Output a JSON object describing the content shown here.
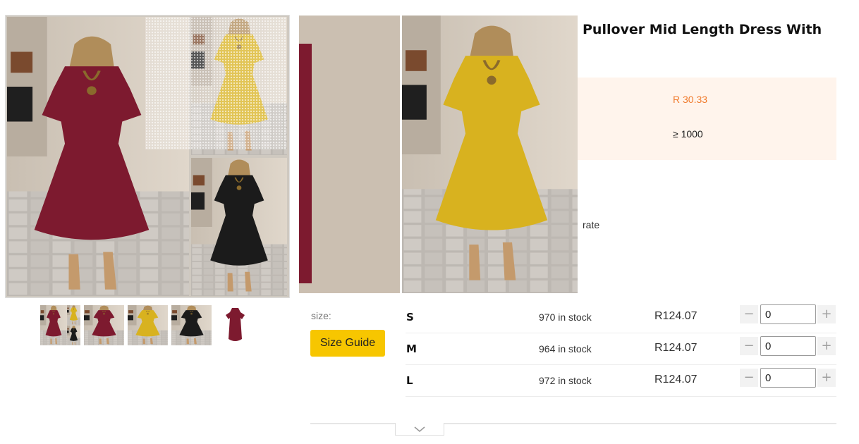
{
  "product": {
    "title": "Pullover Mid Length Dress With"
  },
  "pricing": {
    "price": "R 30.33",
    "moq": "≥ 1000",
    "rate_label": "rate"
  },
  "size_selector": {
    "label": "size:",
    "guide_button": "Size Guide",
    "rows": [
      {
        "size": "S",
        "stock": "970 in stock",
        "price": "R124.07",
        "qty": "0"
      },
      {
        "size": "M",
        "stock": "964 in stock",
        "price": "R124.07",
        "qty": "0"
      },
      {
        "size": "L",
        "stock": "972 in stock",
        "price": "R124.07",
        "qty": "0"
      }
    ]
  },
  "gallery": {
    "thumbnails": [
      "collage-wine-yellow-black",
      "wine-dress",
      "yellow-dress",
      "black-dress",
      "wine-dress-flat"
    ]
  },
  "colors": {
    "wine": "#7d1a2f",
    "yellow": "#d8b21f",
    "black": "#1b1b1b",
    "accent_price": "#f07a2c",
    "price_bg": "#fff4ec",
    "size_guide_bg": "#f7c600"
  },
  "icons": {
    "qty_minus": "minus-icon",
    "qty_plus": "plus-icon",
    "expand": "chevron-down-icon"
  }
}
